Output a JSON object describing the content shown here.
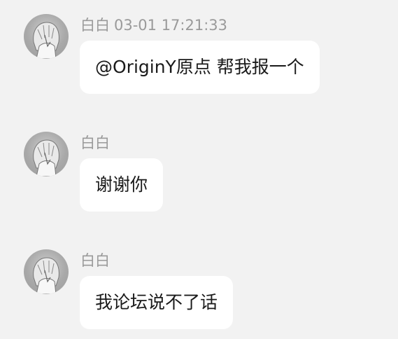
{
  "messages": [
    {
      "sender": "白白",
      "time": "03-01 17:21:33",
      "text": "@OriginY原点 帮我报一个",
      "avatar_icon": "anime-avatar-icon"
    },
    {
      "sender": "白白",
      "time": "",
      "text": "谢谢你",
      "avatar_icon": "anime-avatar-icon"
    },
    {
      "sender": "白白",
      "time": "",
      "text": "我论坛说不了话",
      "avatar_icon": "anime-avatar-icon"
    }
  ],
  "colors": {
    "background": "#f2f2f2",
    "bubble": "#ffffff",
    "meta_text": "#9a9a9a",
    "message_text": "#1a1a1a"
  }
}
